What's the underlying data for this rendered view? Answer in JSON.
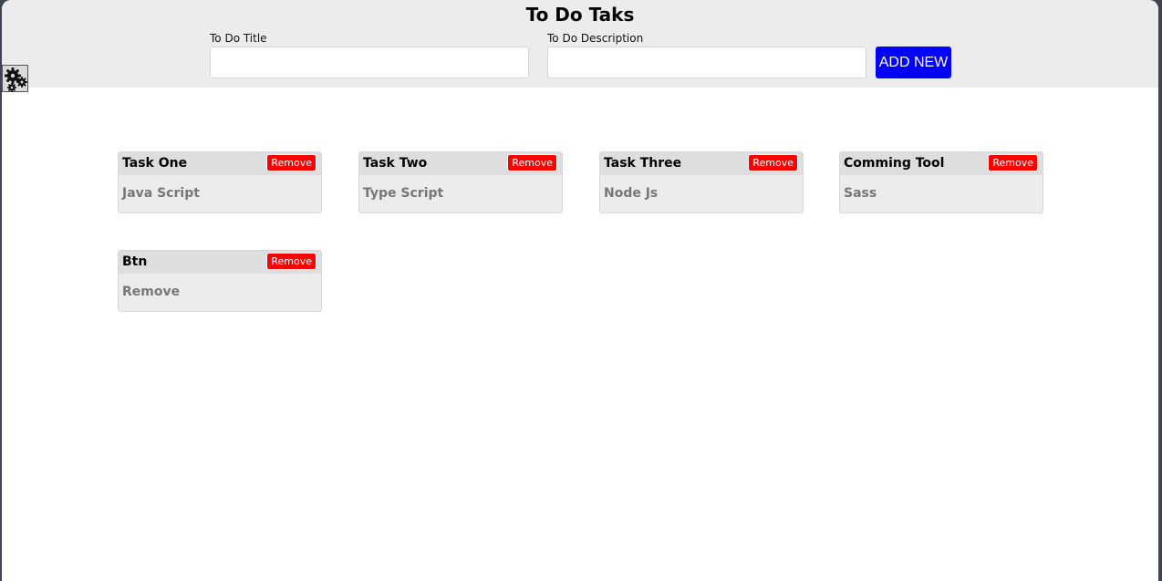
{
  "header": {
    "title": "To Do Taks",
    "title_field_label": "To Do Title",
    "title_field_value": "",
    "description_field_label": "To Do Description",
    "description_field_value": "",
    "add_button_label": "ADD NEW",
    "add_button_color": "#0000ff"
  },
  "settings": {
    "icon": "gears-icon"
  },
  "remove_button_color": "#ff0000",
  "tasks": [
    {
      "title": "Task One",
      "description": "Java Script",
      "remove_label": "Remove"
    },
    {
      "title": "Task Two",
      "description": "Type Script",
      "remove_label": "Remove"
    },
    {
      "title": "Task Three",
      "description": "Node Js",
      "remove_label": "Remove"
    },
    {
      "title": "Comming Tool",
      "description": "Sass",
      "remove_label": "Remove"
    },
    {
      "title": "Btn",
      "description": "Remove",
      "remove_label": "Remove"
    }
  ]
}
